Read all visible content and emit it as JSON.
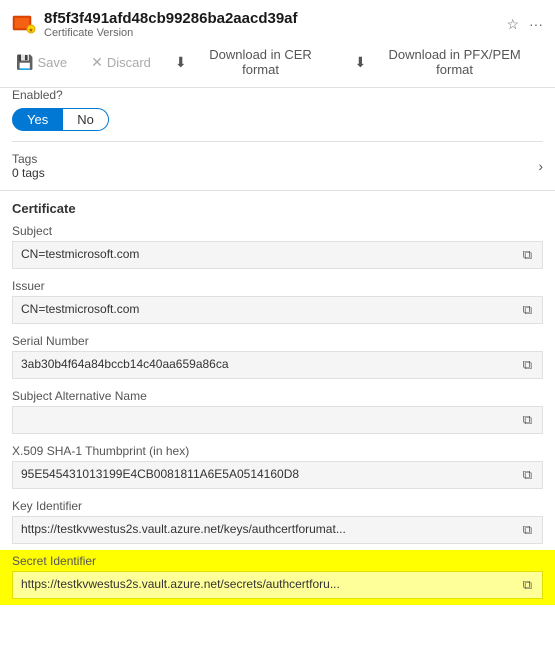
{
  "header": {
    "title": "8f5f3f491afd48cb99286ba2aacd39af",
    "subtitle": "Certificate Version",
    "pin_label": "pin",
    "more_label": "more"
  },
  "toolbar": {
    "save_label": "Save",
    "discard_label": "Discard",
    "download_cer_label": "Download in CER format",
    "download_pfx_label": "Download in PFX/PEM format"
  },
  "enabled": {
    "label": "Enabled?",
    "yes_label": "Yes",
    "no_label": "No"
  },
  "tags": {
    "label": "Tags",
    "count": "0 tags"
  },
  "certificate": {
    "section_title": "Certificate",
    "subject": {
      "label": "Subject",
      "value": "CN=testmicrosoft.com"
    },
    "issuer": {
      "label": "Issuer",
      "value": "CN=testmicrosoft.com"
    },
    "serial_number": {
      "label": "Serial Number",
      "value": "3ab30b4f64a84bccb14c40aa659a86ca"
    },
    "subject_alt_name": {
      "label": "Subject Alternative Name",
      "value": ""
    },
    "thumbprint": {
      "label": "X.509 SHA-1 Thumbprint (in hex)",
      "value": "95E545431013199E4CB0081811A6E5A0514160D8"
    },
    "key_identifier": {
      "label": "Key Identifier",
      "value": "https://testkvwestus2s.vault.azure.net/keys/authcertforumat..."
    },
    "secret_identifier": {
      "label": "Secret Identifier",
      "value": "https://testkvwestus2s.vault.azure.net/secrets/authcertforu..."
    }
  }
}
